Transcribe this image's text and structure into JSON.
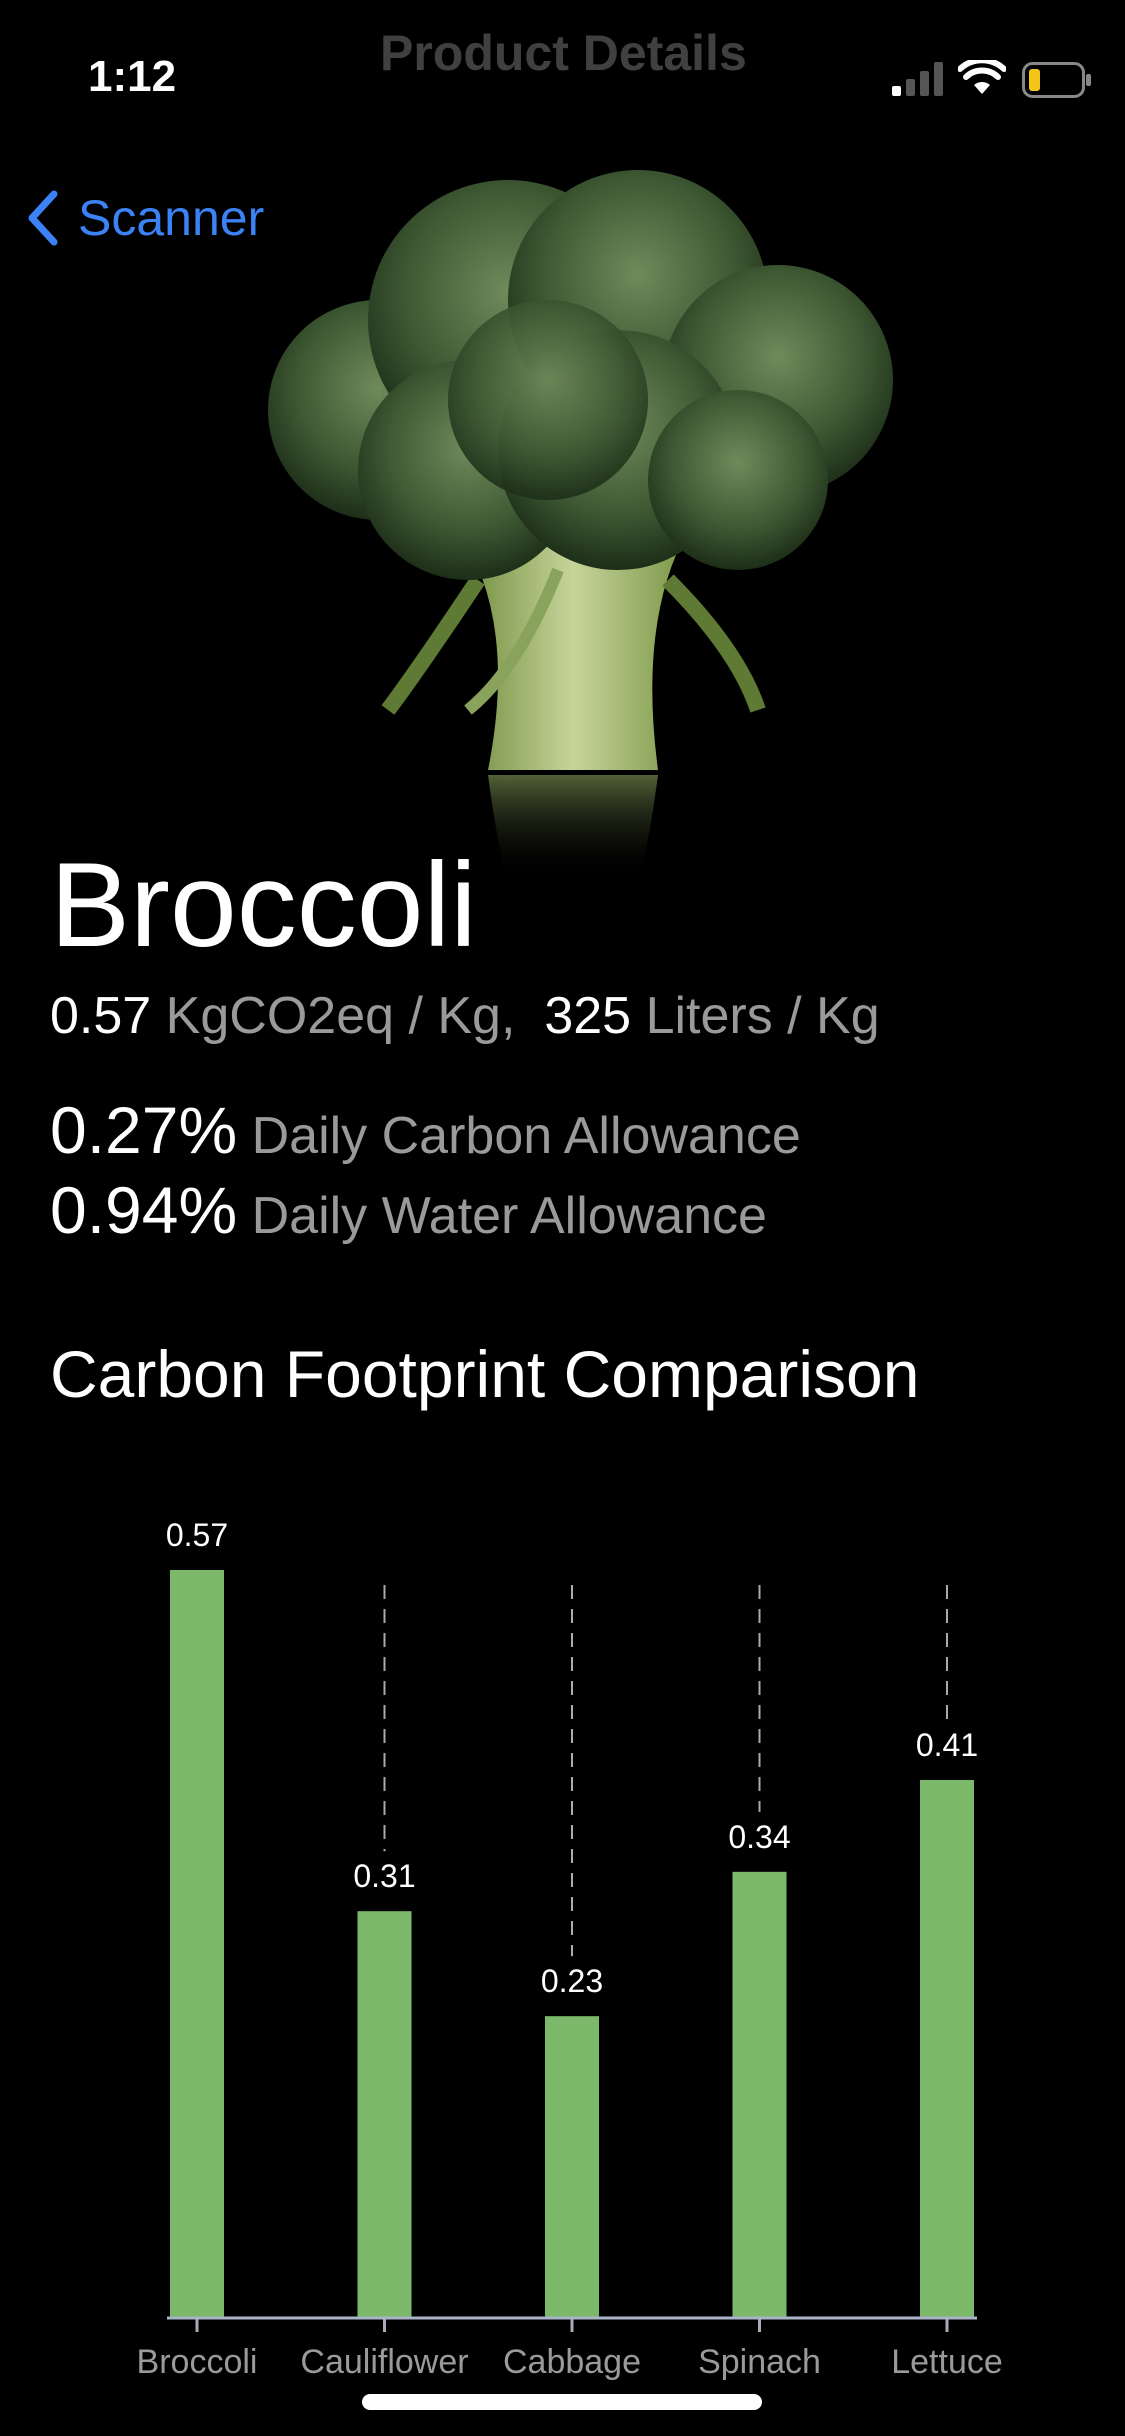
{
  "status_bar": {
    "time": "1:12",
    "icons": [
      "signal-icon",
      "wifi-icon",
      "battery-icon"
    ],
    "battery_color": "#f5c518"
  },
  "nav": {
    "back_label": "Scanner",
    "title": "Product Details",
    "accent": "#3b82f6"
  },
  "hero": {
    "image": "broccoli-photo"
  },
  "product": {
    "name": "Broccoli",
    "carbon_value": "0.57",
    "carbon_unit": "KgCO2eq / Kg,",
    "water_value": "325",
    "water_unit": "Liters / Kg",
    "carbon_allowance_pct": "0.27%",
    "carbon_allowance_label": "Daily Carbon Allowance",
    "water_allowance_pct": "0.94%",
    "water_allowance_label": "Daily Water Allowance"
  },
  "section": {
    "title": "Carbon Footprint Comparison"
  },
  "chart_data": {
    "type": "bar",
    "categories": [
      "Broccoli",
      "Cauliflower",
      "Cabbage",
      "Spinach",
      "Lettuce"
    ],
    "values": [
      0.57,
      0.31,
      0.23,
      0.34,
      0.41
    ],
    "data_labels": [
      "0.57",
      "0.31",
      "0.23",
      "0.34",
      "0.41"
    ],
    "ylim": [
      0,
      0.57
    ],
    "bar_color": "#7cb86a",
    "grid": "vertical dashed",
    "legend": "none",
    "title": "",
    "xlabel": "",
    "ylabel": ""
  }
}
